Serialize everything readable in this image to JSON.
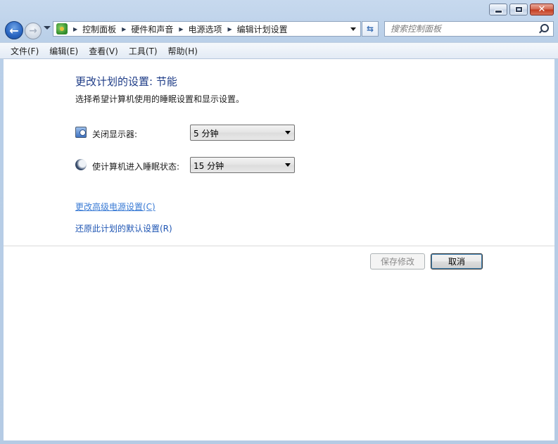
{
  "window": {
    "caption": {
      "minimize_glyph": "minimize-icon",
      "maximize_glyph": "maximize-icon",
      "close_label": "✕"
    }
  },
  "nav": {
    "back_icon": "back-arrow-icon",
    "forward_icon": "forward-arrow-icon",
    "breadcrumbs": [
      "控制面板",
      "硬件和声音",
      "电源选项",
      "编辑计划设置"
    ],
    "search_placeholder": "搜索控制面板"
  },
  "menu": {
    "items": [
      "文件(F)",
      "编辑(E)",
      "查看(V)",
      "工具(T)",
      "帮助(H)"
    ]
  },
  "main": {
    "title": "更改计划的设置: 节能",
    "description": "选择希望计算机使用的睡眠设置和显示设置。",
    "display_off_label": "关闭显示器:",
    "display_off_value": "5 分钟",
    "sleep_label": "使计算机进入睡眠状态:",
    "sleep_value": "15 分钟",
    "advanced_link": "更改高级电源设置(C)",
    "restore_link": "还原此计划的默认设置(R)",
    "save_button": "保存修改",
    "cancel_button": "取消"
  },
  "colors": {
    "title_blue": "#1e3c87",
    "link_blue": "#3a7bd5",
    "frame_blue": "#b9cfe8"
  }
}
